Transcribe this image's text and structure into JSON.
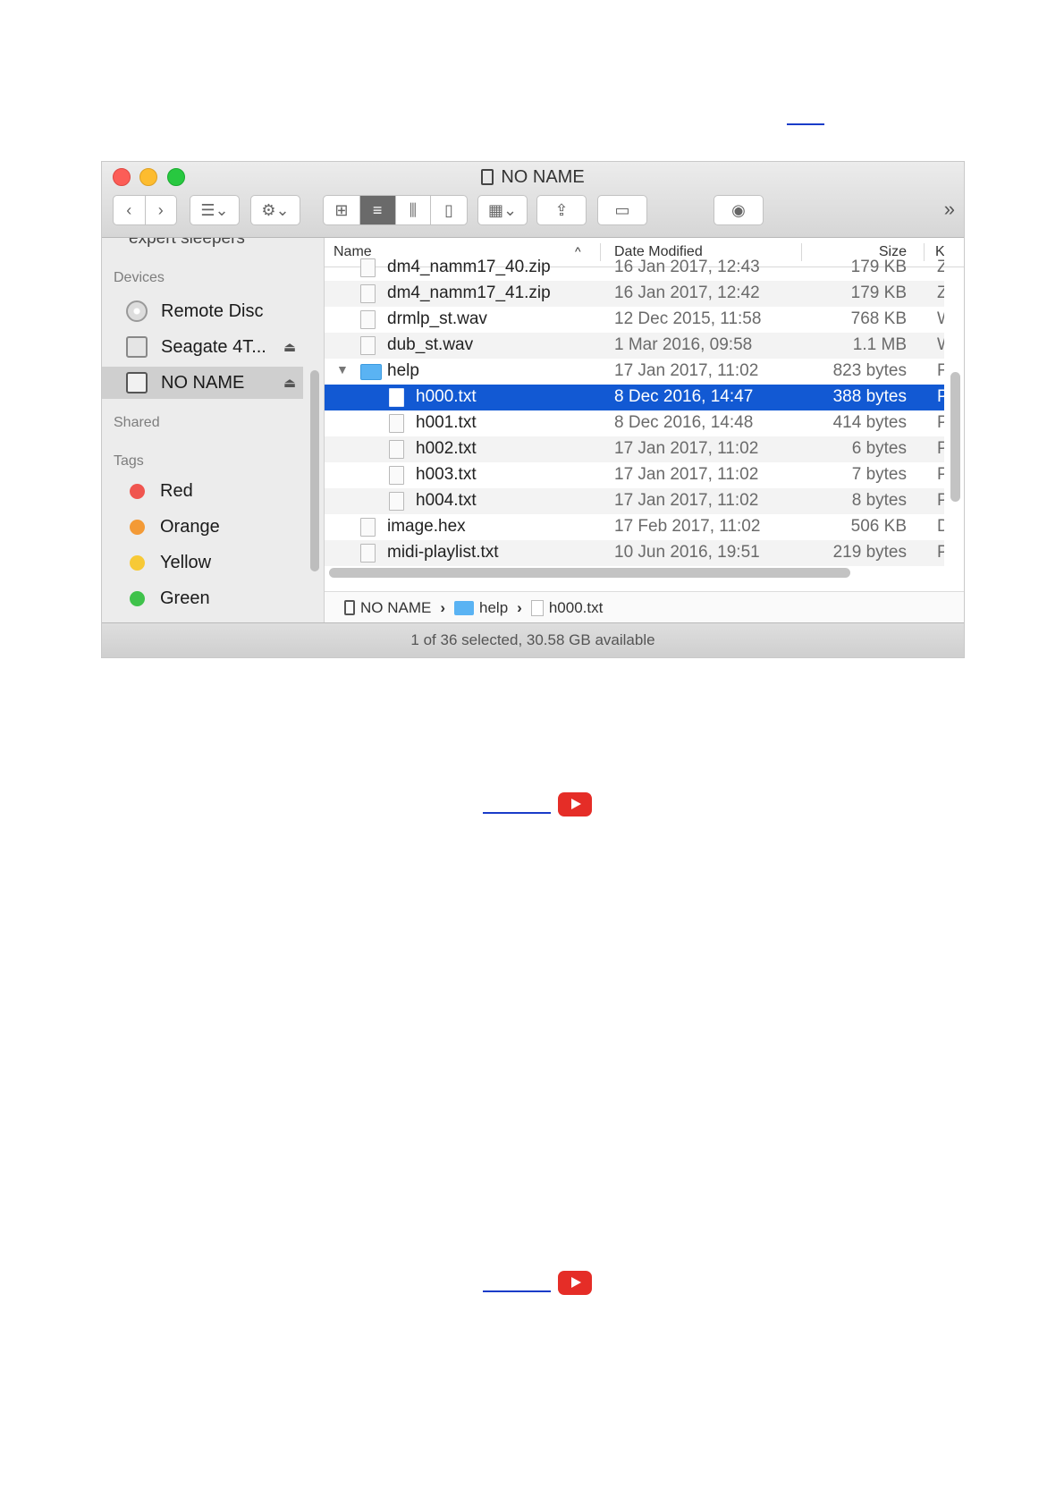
{
  "window": {
    "title": "NO NAME",
    "toolbar": {
      "back": "‹",
      "forward": "›",
      "arrange": "☰⌄",
      "action": "⚙⌄",
      "view_icon": "⊞",
      "view_list": "≡",
      "view_columns": "⫼",
      "view_cover": "▯",
      "group": "▦⌄",
      "share": "⇪",
      "tags": "▭",
      "quicklook": "◉",
      "more": "»"
    }
  },
  "sidebar": {
    "cut_item": "expert sleepers",
    "devices_header": "Devices",
    "devices": [
      {
        "label": "Remote Disc",
        "icon": "cd-icon"
      },
      {
        "label": "Seagate 4T...",
        "icon": "hard-drive-icon",
        "eject": "⏏"
      },
      {
        "label": "NO NAME",
        "icon": "sd-card-icon",
        "eject": "⏏",
        "selected": true
      }
    ],
    "shared_header": "Shared",
    "tags_header": "Tags",
    "tags": [
      {
        "label": "Red",
        "color": "#f0554f"
      },
      {
        "label": "Orange",
        "color": "#f39a36"
      },
      {
        "label": "Yellow",
        "color": "#f7c936"
      },
      {
        "label": "Green",
        "color": "#3fc24b"
      }
    ]
  },
  "columns": {
    "name": "Name",
    "sort": "^",
    "date": "Date Modified",
    "size": "Size",
    "kind": "K"
  },
  "files": [
    {
      "name": "dm4_namm17_40.zip",
      "date": "16 Jan 2017, 12:43",
      "size": "179 KB",
      "kind": "Z",
      "indent": 1,
      "type": "zip"
    },
    {
      "name": "dm4_namm17_41.zip",
      "date": "16 Jan 2017, 12:42",
      "size": "179 KB",
      "kind": "Z",
      "indent": 1,
      "type": "zip"
    },
    {
      "name": "drmlp_st.wav",
      "date": "12 Dec 2015, 11:58",
      "size": "768 KB",
      "kind": "W",
      "indent": 1,
      "type": "audio"
    },
    {
      "name": "dub_st.wav",
      "date": "1 Mar 2016, 09:58",
      "size": "1.1 MB",
      "kind": "W",
      "indent": 1,
      "type": "audio"
    },
    {
      "name": "help",
      "date": "17 Jan 2017, 11:02",
      "size": "823 bytes",
      "kind": "F",
      "indent": 1,
      "type": "folder"
    },
    {
      "name": "h000.txt",
      "date": "8 Dec 2016, 14:47",
      "size": "388 bytes",
      "kind": "P",
      "indent": 2,
      "type": "text",
      "selected": true
    },
    {
      "name": "h001.txt",
      "date": "8 Dec 2016, 14:48",
      "size": "414 bytes",
      "kind": "P",
      "indent": 2,
      "type": "text"
    },
    {
      "name": "h002.txt",
      "date": "17 Jan 2017, 11:02",
      "size": "6 bytes",
      "kind": "P",
      "indent": 2,
      "type": "text"
    },
    {
      "name": "h003.txt",
      "date": "17 Jan 2017, 11:02",
      "size": "7 bytes",
      "kind": "P",
      "indent": 2,
      "type": "text"
    },
    {
      "name": "h004.txt",
      "date": "17 Jan 2017, 11:02",
      "size": "8 bytes",
      "kind": "P",
      "indent": 2,
      "type": "text"
    },
    {
      "name": "image.hex",
      "date": "17 Feb 2017, 11:02",
      "size": "506 KB",
      "kind": "D",
      "indent": 1,
      "type": "doc"
    },
    {
      "name": "midi-playlist.txt",
      "date": "10 Jun 2016, 19:51",
      "size": "219 bytes",
      "kind": "P",
      "indent": 1,
      "type": "text"
    }
  ],
  "pathbar": {
    "items": [
      "NO NAME",
      "help",
      "h000.txt"
    ],
    "separator": "›"
  },
  "status": "1 of 36 selected, 30.58 GB available"
}
